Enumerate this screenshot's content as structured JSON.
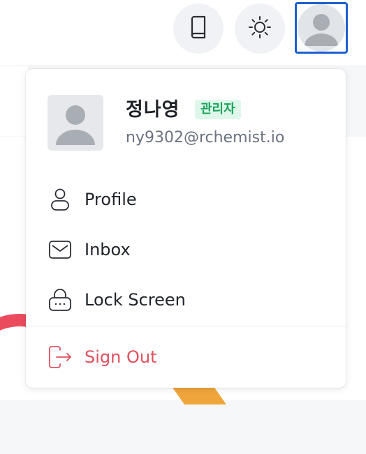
{
  "topbar": {
    "book_icon": "book-icon",
    "theme_icon": "sun-icon",
    "avatar_icon": "user-avatar-icon"
  },
  "user": {
    "name": "정나영",
    "role": "관리자",
    "email": "ny9302@rchemist.io"
  },
  "menu": {
    "items": [
      {
        "label": "Profile",
        "icon": "person-icon"
      },
      {
        "label": "Inbox",
        "icon": "envelope-icon"
      },
      {
        "label": "Lock Screen",
        "icon": "lock-icon"
      }
    ],
    "signout": {
      "label": "Sign Out",
      "icon": "sign-out-icon"
    }
  },
  "colors": {
    "accent_border": "#1c5fd4",
    "badge_bg": "#dff7ea",
    "badge_text": "#1aa35c",
    "signout": "#e0505d"
  }
}
